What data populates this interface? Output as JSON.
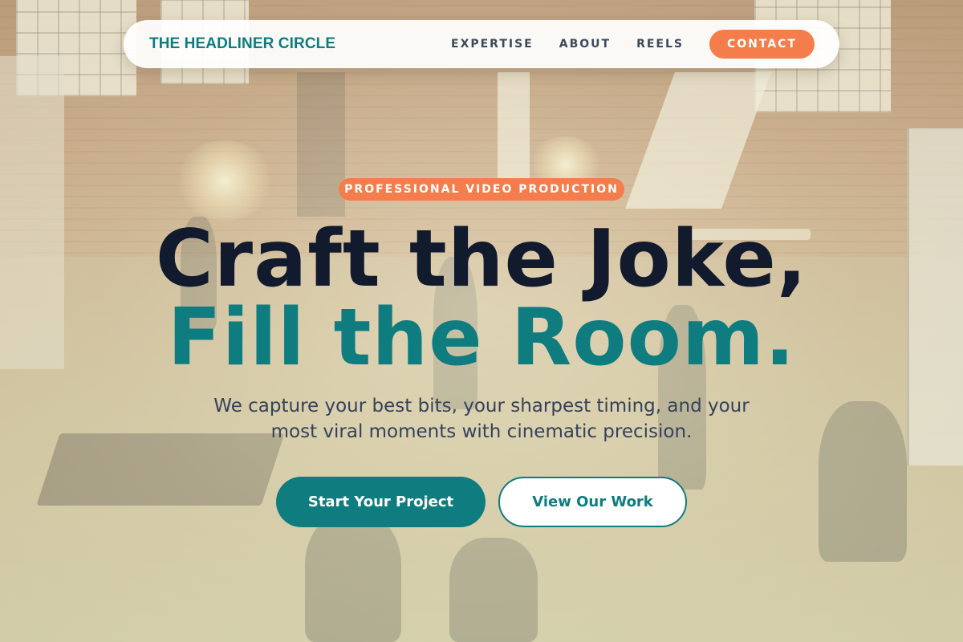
{
  "nav": {
    "brand": "THE HEADLINER CIRCLE",
    "links": [
      "EXPERTISE",
      "ABOUT",
      "REELS"
    ],
    "contact_label": "CONTACT"
  },
  "hero": {
    "badge": "PROFESSIONAL VIDEO PRODUCTION",
    "headline_line1": "Craft the Joke,",
    "headline_line2": "Fill the Room.",
    "subtitle": "We capture your best bits, your sharpest timing, and your most viral moments with cinematic precision.",
    "primary_cta": "Start Your Project",
    "secondary_cta": "View Our Work"
  },
  "colors": {
    "brand_teal": "#0f7c80",
    "accent_orange": "#f47d4b",
    "headline_dark": "#121a2e",
    "text_slate": "#34425a"
  }
}
